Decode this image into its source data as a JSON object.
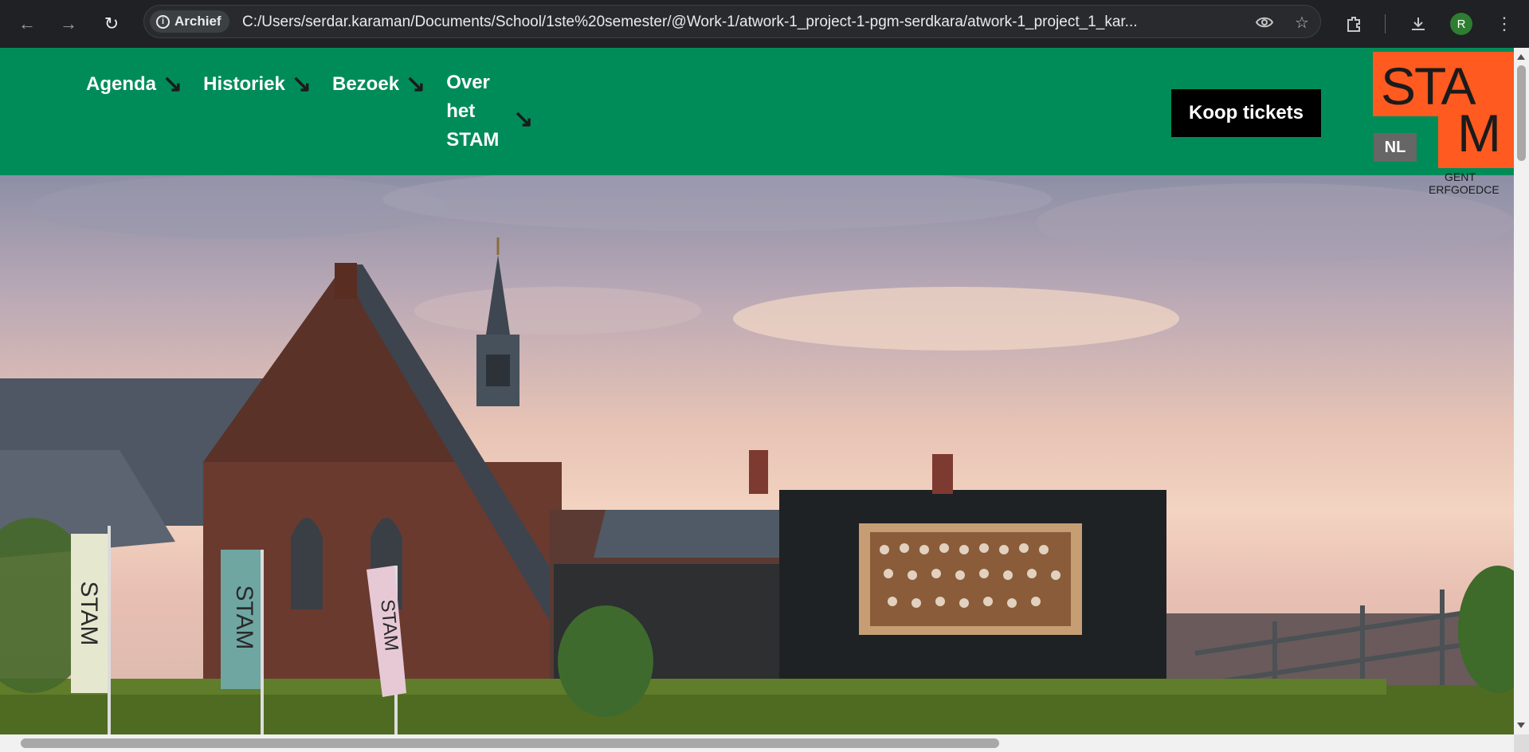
{
  "browser": {
    "chip_label": "Archief",
    "url": "C:/Users/serdar.karaman/Documents/School/1ste%20semester/@Work-1/atwork-1_project-1-pgm-serdkara/atwork-1_project_1_kar...",
    "profile_initial": "R"
  },
  "header": {
    "nav": [
      {
        "label": "Agenda"
      },
      {
        "label": "Historiek"
      },
      {
        "label": "Bezoek"
      },
      {
        "label": "Over het STAM"
      }
    ],
    "tickets_label": "Koop tickets",
    "lang_label": "NL",
    "logo": {
      "line1": "STA",
      "line2": "M",
      "sub1": "GENT",
      "sub2": "ERFGOEDCE"
    }
  },
  "hero": {
    "banner_text": "STAM"
  },
  "colors": {
    "header_bg": "#008c59",
    "logo_orange": "#ff5a1f",
    "tickets_bg": "#000000"
  }
}
